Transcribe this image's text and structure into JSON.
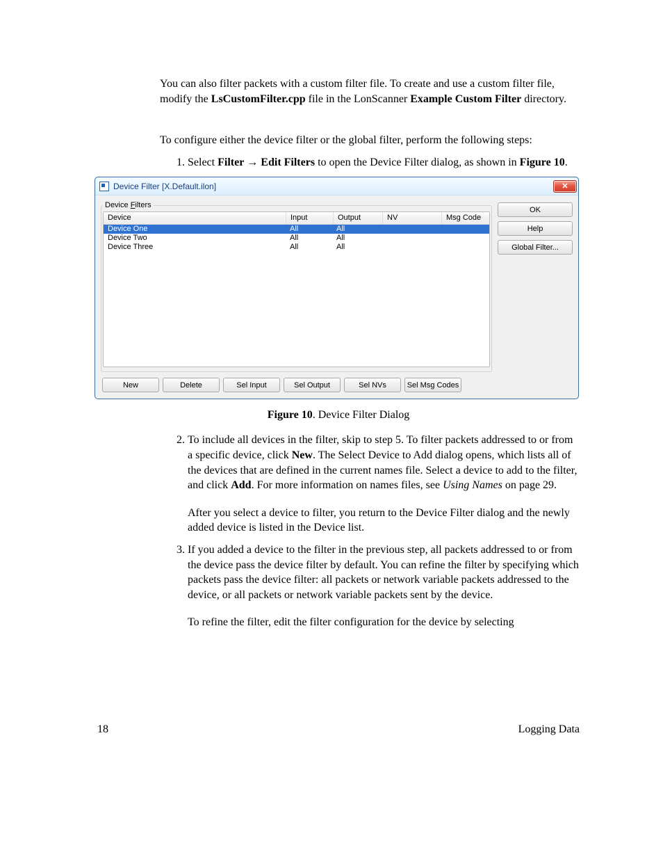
{
  "intro": {
    "para1_a": "You can also filter packets with a custom filter file.  To create and use a custom filter file, modify the ",
    "file": "LsCustomFilter.cpp",
    "para1_b": " file in the LonScanner ",
    "example": "Example Custom Filter",
    "para1_c": " directory.",
    "para2": "To configure either the device filter or the global filter, perform the following steps:"
  },
  "steps": {
    "s1_a": "Select ",
    "s1_filter": "Filter",
    "s1_arrow": " → ",
    "s1_edit": "Edit Filters",
    "s1_b": " to open the Device Filter dialog, as shown in ",
    "s1_fig": "Figure 10",
    "s1_c": ".",
    "s2_a": "To include all devices in the filter, skip to step 5.  To filter packets addressed to or from a specific device, click ",
    "s2_new": "New",
    "s2_b": ".  The Select Device to Add dialog opens, which lists all of the devices that are defined in the current names file.  Select a device to add to the filter, and click ",
    "s2_add": "Add",
    "s2_c": ".  For more information on names files, see ",
    "s2_using": "Using Names",
    "s2_d": " on page 29.",
    "s2_p2": "After you select a device to filter, you return to the Device Filter dialog and the newly added device is listed in the Device list.",
    "s3_a": "If you added a device to the filter in the previous step, all packets addressed to or from the device pass the device filter by default.  You can refine the filter by specifying which packets pass the device filter:  all packets or network variable packets addressed to the device, or all packets or network variable packets sent by the device.",
    "s3_p2": "To refine the filter, edit the filter configuration for the device by selecting"
  },
  "dialog": {
    "title": "Device Filter [X.Default.ilon]",
    "groupLabelPre": "Device ",
    "groupLabelUL": "F",
    "groupLabelPost": "ilters",
    "columns": {
      "device": "Device",
      "input": "Input",
      "output": "Output",
      "nv": "NV",
      "msg": "Msg Code"
    },
    "rows": [
      {
        "device": "Device One",
        "input": "All",
        "output": "All",
        "nv": "",
        "msg": ""
      },
      {
        "device": "Device Two",
        "input": "All",
        "output": "All",
        "nv": "",
        "msg": ""
      },
      {
        "device": "Device Three",
        "input": "All",
        "output": "All",
        "nv": "",
        "msg": ""
      }
    ],
    "bottomButtons": {
      "new": "New",
      "delete": "Delete",
      "selInput": "Sel Input",
      "selOutput": "Sel Output",
      "selNVs": "Sel NVs",
      "selMsg": "Sel Msg Codes"
    },
    "sideButtons": {
      "ok": "OK",
      "help": "Help",
      "global": "Global Filter..."
    },
    "closeGlyph": "✕"
  },
  "figure": {
    "label": "Figure 10",
    "caption": ". Device Filter Dialog"
  },
  "footer": {
    "page": "18",
    "section": "Logging Data"
  }
}
